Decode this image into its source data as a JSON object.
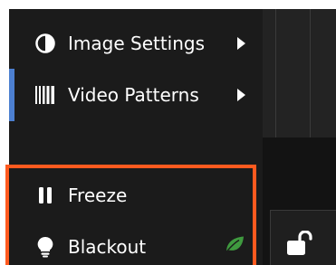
{
  "menu": {
    "items": [
      {
        "label": "Image Settings",
        "icon": "half-circle-icon",
        "has_submenu": true
      },
      {
        "label": "Video Patterns",
        "icon": "bars-pattern-icon",
        "has_submenu": true,
        "active": true
      },
      {
        "label": "Freeze",
        "icon": "pause-icon",
        "has_submenu": false
      },
      {
        "label": "Blackout",
        "icon": "lightbulb-icon",
        "has_submenu": false,
        "badge_icon": "leaf-icon"
      }
    ]
  },
  "colors": {
    "panel_bg": "#1b1b1b",
    "text": "#ffffff",
    "active_indicator": "#4c7fd0",
    "highlight_border": "#ff5a1f",
    "leaf": "#3f9a3f"
  },
  "toolbar": {
    "lock_icon": "unlock-icon"
  }
}
